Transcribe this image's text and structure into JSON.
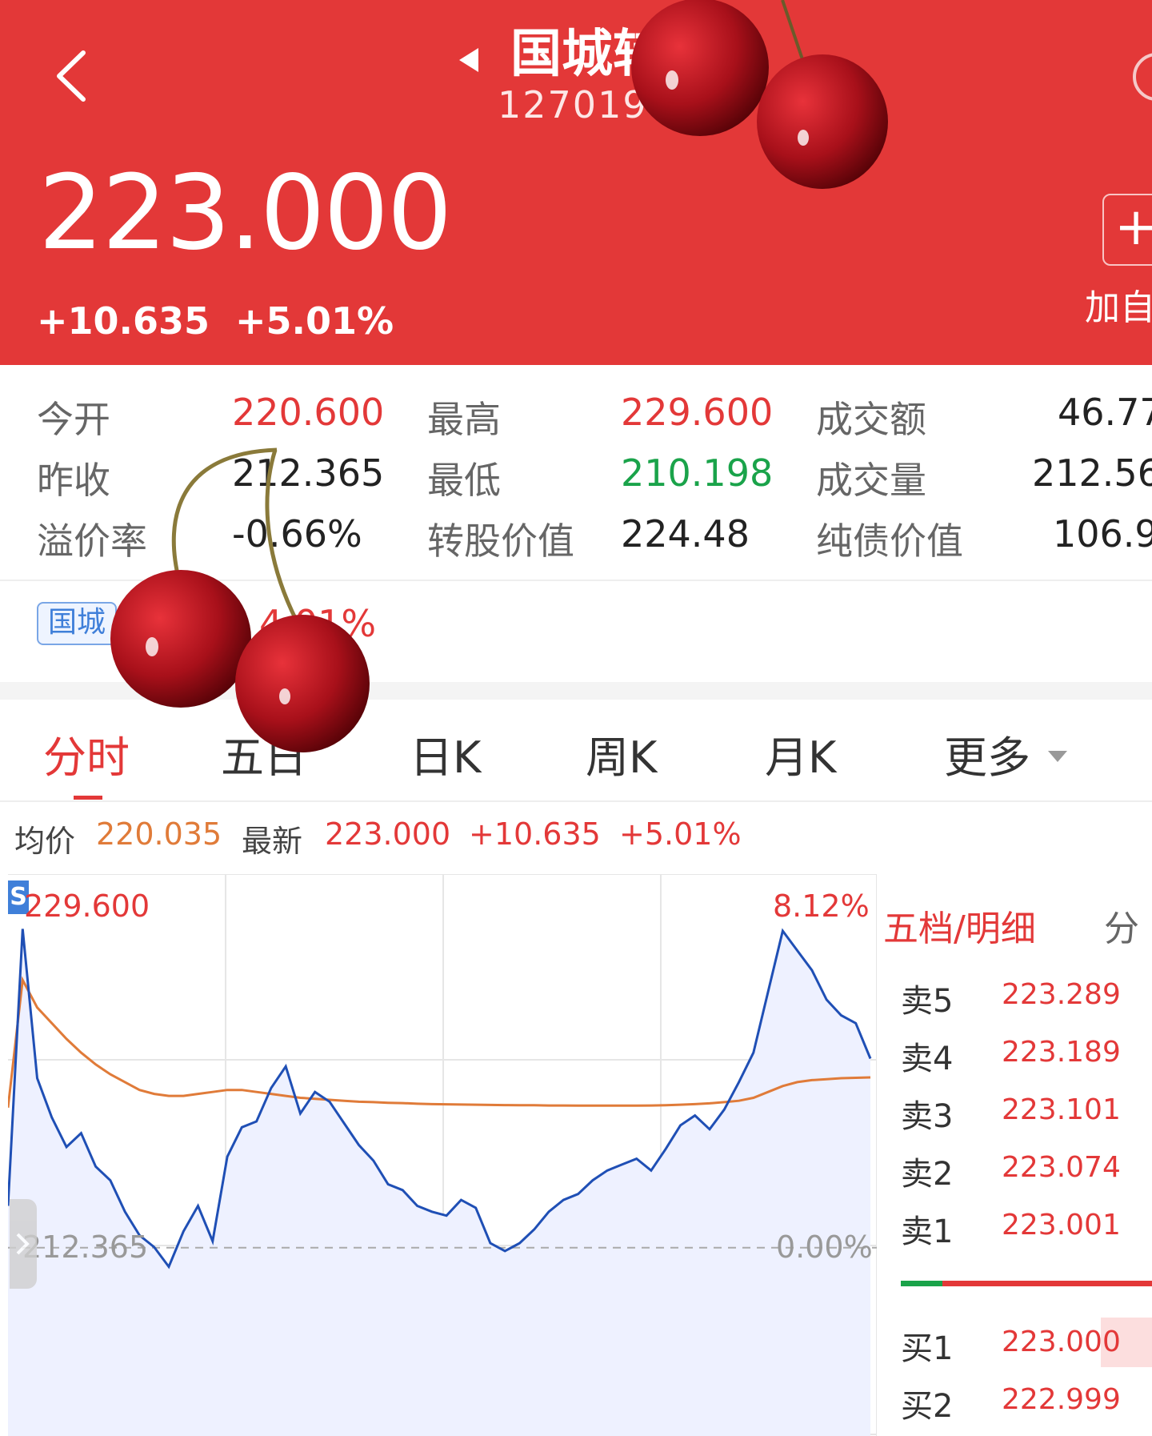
{
  "header": {
    "title": "国城转",
    "code": "127019",
    "price": "223.000",
    "change_abs": "+10.635",
    "change_pct": "+5.01%",
    "add_button": "+",
    "add_label": "加自"
  },
  "stats": [
    {
      "label": "今开",
      "value": "220.600"
    },
    {
      "label": "最高",
      "value": "229.600"
    },
    {
      "label": "成交额",
      "value": "46.77"
    },
    {
      "label": "昨收",
      "value": "212.365"
    },
    {
      "label": "最低",
      "value": "210.198"
    },
    {
      "label": "成交量",
      "value": "212.56"
    },
    {
      "label": "溢价率",
      "value": "-0.66%"
    },
    {
      "label": "转股价值",
      "value": "224.48"
    },
    {
      "label": "纯债价值",
      "value": "106.9"
    }
  ],
  "tag": {
    "label": "国城",
    "change": "4.01%"
  },
  "tabs": [
    "分时",
    "五日",
    "日K",
    "周K",
    "月K",
    "更多"
  ],
  "info": {
    "avg_label": "均价",
    "avg_value": "220.035",
    "latest_label": "最新",
    "latest_value": "223.000",
    "change_abs": "+10.635",
    "change_pct": "+5.01%"
  },
  "chart_labels": {
    "high": "229.600",
    "high_pct": "8.12%",
    "base": "212.365",
    "base_pct": "0.00%",
    "badge": "S"
  },
  "order_book": {
    "title": "五档/明细",
    "tab2": "分",
    "rows": [
      {
        "label": "卖5",
        "price": "223.289"
      },
      {
        "label": "卖4",
        "price": "223.189"
      },
      {
        "label": "卖3",
        "price": "223.101"
      },
      {
        "label": "卖2",
        "price": "223.074"
      },
      {
        "label": "卖1",
        "price": "223.001"
      },
      {
        "label": "买1",
        "price": "223.000"
      },
      {
        "label": "买2",
        "price": "222.999"
      }
    ]
  },
  "chart_data": {
    "type": "line",
    "title": "",
    "xlabel": "",
    "ylabel": "",
    "ylim": [
      210.198,
      229.6
    ],
    "baseline": 212.365,
    "series": [
      {
        "name": "最新",
        "color": "#1f4fb5",
        "values": [
          214.5,
          228.6,
          221.0,
          219.0,
          217.5,
          218.2,
          216.5,
          215.8,
          214.2,
          213.0,
          212.4,
          211.4,
          213.2,
          214.5,
          212.7,
          217.0,
          218.5,
          218.8,
          220.5,
          221.6,
          219.2,
          220.3,
          219.8,
          218.7,
          217.6,
          216.8,
          215.6,
          215.3,
          214.5,
          214.2,
          214.0,
          214.8,
          214.4,
          212.6,
          212.2,
          212.6,
          213.3,
          214.2,
          214.8,
          215.1,
          215.8,
          216.3,
          216.6,
          216.9,
          216.3,
          217.4,
          218.6,
          219.1,
          218.4,
          219.4,
          220.8,
          222.3,
          225.4,
          228.5,
          227.5,
          226.5,
          225.0,
          224.2,
          223.8,
          222.0
        ]
      },
      {
        "name": "均价",
        "color": "#e07b39",
        "values": [
          219.5,
          226.0,
          224.6,
          223.8,
          223.0,
          222.3,
          221.7,
          221.2,
          220.8,
          220.4,
          220.2,
          220.1,
          220.1,
          220.2,
          220.3,
          220.4,
          220.4,
          220.3,
          220.2,
          220.1,
          220.0,
          219.95,
          219.9,
          219.85,
          219.8,
          219.78,
          219.75,
          219.73,
          219.7,
          219.68,
          219.67,
          219.66,
          219.65,
          219.64,
          219.63,
          219.62,
          219.62,
          219.61,
          219.61,
          219.6,
          219.6,
          219.6,
          219.6,
          219.6,
          219.61,
          219.62,
          219.65,
          219.68,
          219.72,
          219.78,
          219.85,
          220.0,
          220.3,
          220.6,
          220.8,
          220.9,
          220.95,
          221.0,
          221.02,
          221.04
        ]
      }
    ]
  },
  "colors": {
    "brand": "#e33838",
    "down": "#1aa34a",
    "line": "#1f4fb5",
    "avg": "#e07b39"
  }
}
